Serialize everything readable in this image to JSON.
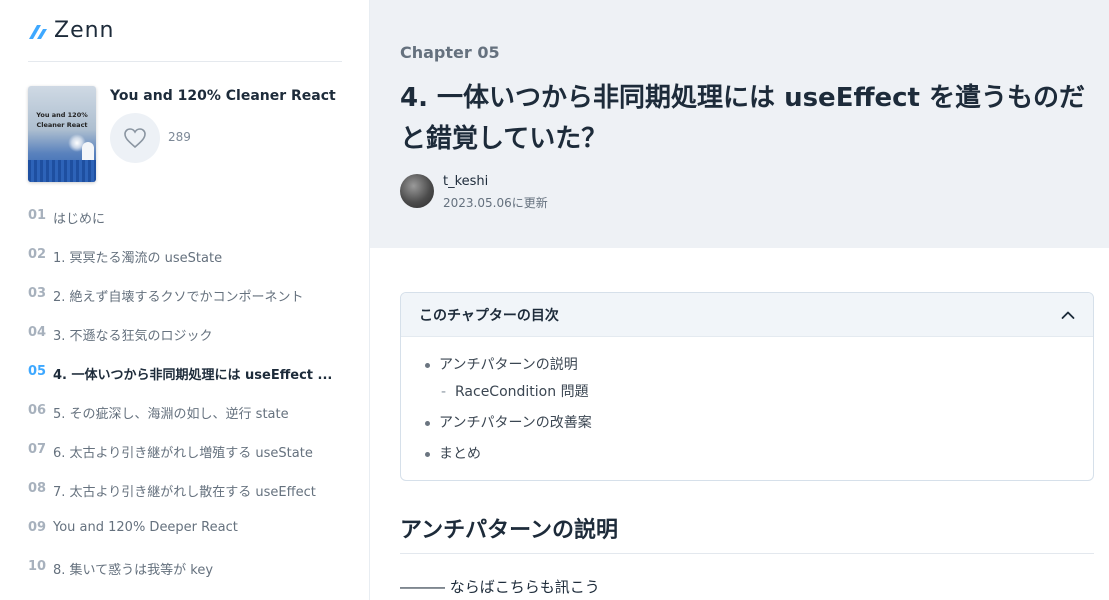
{
  "app": {
    "logo_text": "Zenn",
    "accent": "#3ea8ff"
  },
  "book": {
    "title": "You and 120% Cleaner React",
    "cover_title": "You and 120% Cleaner React",
    "like_count": "289"
  },
  "chapters": [
    {
      "num": "01",
      "label": "はじめに",
      "active": false
    },
    {
      "num": "02",
      "label": "1. 冥冥たる濁流の useState",
      "active": false
    },
    {
      "num": "03",
      "label": "2. 絶えず自壊するクソでかコンポーネント",
      "active": false
    },
    {
      "num": "04",
      "label": "3. 不遜なる狂気のロジック",
      "active": false
    },
    {
      "num": "05",
      "label": "4. 一体いつから非同期処理には useEffect ...",
      "active": true
    },
    {
      "num": "06",
      "label": "5. その疵深し、海淵の如し、逆行 state",
      "active": false
    },
    {
      "num": "07",
      "label": "6. 太古より引き継がれし増殖する useState",
      "active": false
    },
    {
      "num": "08",
      "label": "7. 太古より引き継がれし散在する useEffect",
      "active": false
    },
    {
      "num": "09",
      "label": "You and 120% Deeper React",
      "active": false
    },
    {
      "num": "10",
      "label": "8. 集いて惑うは我等が key",
      "active": false
    }
  ],
  "main": {
    "chapter_label": "Chapter 05",
    "title": "4. 一体いつから非同期処理には useEffect を遣うものだと錯覚していた？",
    "author": "t_keshi",
    "updated": "2023.05.06に更新",
    "toc_title": "このチャプターの目次",
    "toc_items": [
      {
        "label": "アンチパターンの説明",
        "sub": false
      },
      {
        "label": "RaceCondition 問題",
        "sub": true
      },
      {
        "label": "アンチパターンの改善案",
        "sub": false
      },
      {
        "label": "まとめ",
        "sub": false
      }
    ],
    "section_heading": "アンチパターンの説明",
    "paragraph": "――― ならばこちらも訊こう"
  }
}
